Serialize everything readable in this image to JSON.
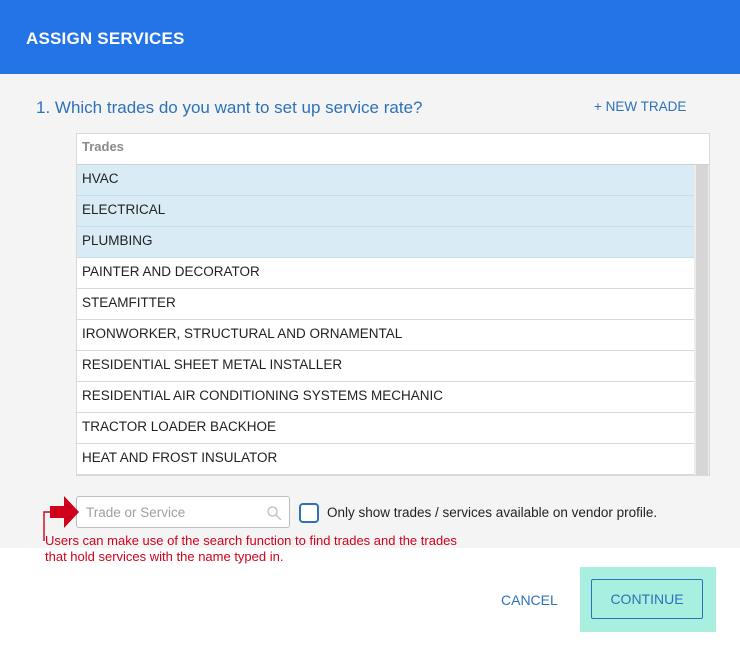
{
  "dialog": {
    "title": "ASSIGN SERVICES",
    "question": "1. Which trades do you want to set up service rate?",
    "new_trade_label": "+ NEW TRADE"
  },
  "table": {
    "header": "Trades",
    "rows": [
      {
        "label": "HVAC",
        "selected": true
      },
      {
        "label": "ELECTRICAL",
        "selected": true
      },
      {
        "label": "PLUMBING",
        "selected": true
      },
      {
        "label": "PAINTER AND DECORATOR",
        "selected": false
      },
      {
        "label": "STEAMFITTER",
        "selected": false
      },
      {
        "label": "IRONWORKER, STRUCTURAL AND ORNAMENTAL",
        "selected": false
      },
      {
        "label": "RESIDENTIAL SHEET METAL INSTALLER",
        "selected": false
      },
      {
        "label": "RESIDENTIAL AIR CONDITIONING SYSTEMS MECHANIC",
        "selected": false
      },
      {
        "label": "TRACTOR LOADER BACKHOE",
        "selected": false
      },
      {
        "label": "HEAT AND FROST INSULATOR",
        "selected": false
      }
    ]
  },
  "search": {
    "placeholder": "Trade or Service",
    "value": "",
    "icon": "search-icon"
  },
  "filter": {
    "checked": false,
    "label": "Only show trades / services available on vendor profile."
  },
  "annotation": {
    "text": "Users can make use of the search function to find trades and the trades that hold services with the name typed in.",
    "color": "#d0021b"
  },
  "footer": {
    "cancel_label": "CANCEL",
    "continue_label": "CONTINUE"
  },
  "colors": {
    "header": "#2374e6",
    "accent": "#2d72b9",
    "selected_row": "#d9ecf5",
    "highlight": "#a8efe0"
  }
}
